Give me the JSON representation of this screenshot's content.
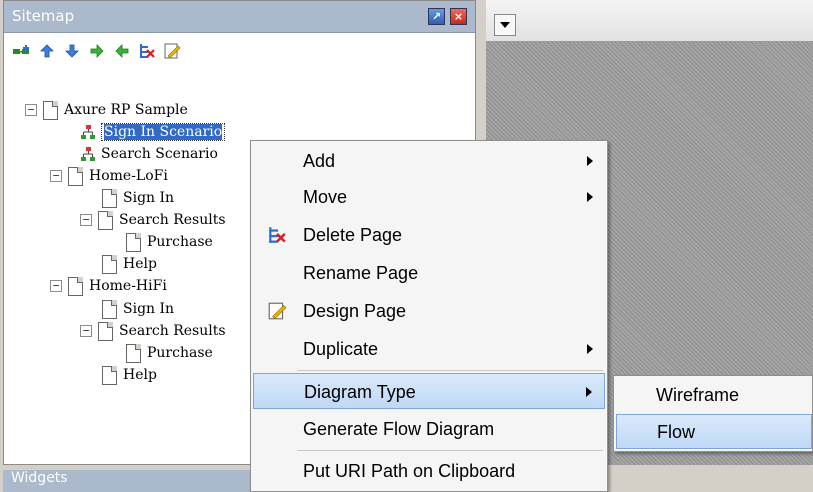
{
  "sitemap": {
    "title": "Sitemap",
    "tree": [
      {
        "label": "Axure RP Sample"
      },
      {
        "label": "Sign In Scenario"
      },
      {
        "label": "Search Scenario"
      },
      {
        "label": "Home-LoFi"
      },
      {
        "label": "Sign In"
      },
      {
        "label": "Search Results"
      },
      {
        "label": "Purchase"
      },
      {
        "label": "Help"
      },
      {
        "label": "Home-HiFi"
      },
      {
        "label": "Sign In"
      },
      {
        "label": "Search Results"
      },
      {
        "label": "Purchase"
      },
      {
        "label": "Help"
      }
    ],
    "toolbar_icons": [
      "add-page-icon",
      "move-up-icon",
      "move-down-icon",
      "indent-icon",
      "outdent-icon",
      "delete-page-icon",
      "edit-page-icon"
    ]
  },
  "bottom_panel": {
    "title": "Widgets"
  },
  "context_menu": {
    "items": [
      {
        "label": "Add"
      },
      {
        "label": "Move"
      },
      {
        "label": "Delete Page"
      },
      {
        "label": "Rename Page"
      },
      {
        "label": "Design Page"
      },
      {
        "label": "Duplicate"
      },
      {
        "label": "Diagram Type"
      },
      {
        "label": "Generate Flow Diagram"
      },
      {
        "label": "Put URI Path on Clipboard"
      }
    ]
  },
  "submenu": {
    "items": [
      {
        "label": "Wireframe"
      },
      {
        "label": "Flow"
      }
    ]
  },
  "colors": {
    "header": "#aab9cc",
    "highlight": "#bfd8f6",
    "selection": "#316ac5"
  }
}
